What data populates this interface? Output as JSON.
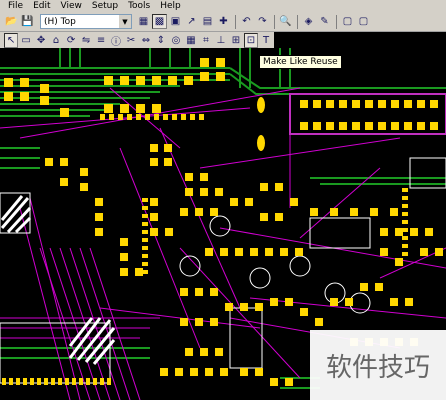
{
  "menu": {
    "file": "File",
    "edit": "Edit",
    "view": "View",
    "setup": "Setup",
    "tools": "Tools",
    "help": "Help"
  },
  "toolbar": {
    "layer_value": "(H) Top"
  },
  "tooltip": {
    "text": "Make Like Reuse"
  },
  "watermark": {
    "text": "软件技巧"
  },
  "colors": {
    "pad": "#ffd700",
    "trace_green": "#1a9a20",
    "ratsnest": "#d000d0",
    "silk": "#ffffff",
    "board_bg": "#000000"
  },
  "icons": [
    "open-icon",
    "save-icon",
    "cursor-icon",
    "zoom-icon",
    "undo-icon",
    "redo-icon",
    "search-icon"
  ]
}
